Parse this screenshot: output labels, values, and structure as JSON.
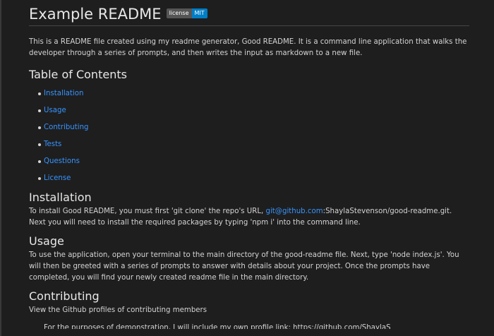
{
  "readme": {
    "title": "Example README",
    "badge": {
      "label": "license",
      "value": "MIT",
      "label_color": "#555555",
      "value_color": "#007ec6"
    },
    "intro": "This is a README file created using my readme generator, Good README. It is a command line application that walks the developer through a series of prompts, and then writes the input as markdown to a new file.",
    "toc": {
      "title": "Table of Contents",
      "items": [
        {
          "label": "Installation"
        },
        {
          "label": "Usage"
        },
        {
          "label": "Contributing"
        },
        {
          "label": "Tests"
        },
        {
          "label": "Questions"
        },
        {
          "label": "License"
        }
      ]
    },
    "installation": {
      "title": "Installation",
      "text_before": "To install Good README, you must first 'git clone' the repo's URL, ",
      "link": "git@github.com",
      "text_after": ":ShaylaStevenson/good-readme.git. Next you will need to install the required packages by typing 'npm i' into the command line."
    },
    "usage": {
      "title": "Usage",
      "text": "To use the application, open your terminal to the main directory of the good-readme file. Next, type 'node index.js'. You will then be greeted with a series of prompts to answer with details about your project. Once the prompts have completed, you will find your newly created readme file in the main directory."
    },
    "contributing": {
      "title": "Contributing",
      "text": "View the Github profiles of contributing members",
      "partial_line": "For the purposes of demonstration, I will include my own profile link: https://github.com/ShaylaS"
    }
  },
  "colors": {
    "background": "#1e1e1e",
    "text": "#d4d4d4",
    "link": "#3794ff"
  }
}
